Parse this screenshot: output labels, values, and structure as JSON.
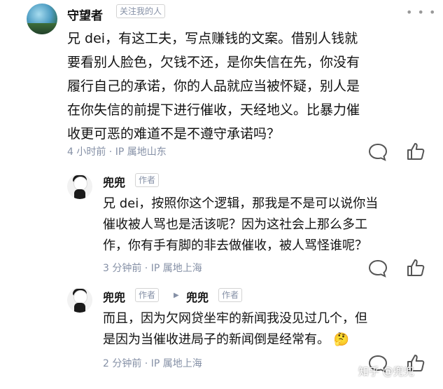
{
  "main_comment": {
    "username": "守望者",
    "follow_tag": "关注我的人",
    "text_lines": [
      "兄 dei，有这工夫，写点赚钱的文案。借别人钱就",
      "要看别人脸色，欠钱不还，是你失信在先，你没有",
      "履行自己的承诺，你的人品就应当被怀疑，别人是",
      "在你失信的前提下进行催收，天经地义。比暴力催",
      "收更可恶的难道不是不遵守承诺吗？"
    ],
    "meta": "4 小时前 · IP 属地山东"
  },
  "reply1": {
    "username": "兜兜",
    "author_tag": "作者",
    "text_lines": [
      "兄 dei，按照你这个逻辑，那我是不是可以说你当",
      "催收被人骂也是活该呢？因为这社会上那么多工",
      "作，你有手有脚的非去做催收，被人骂怪谁呢？"
    ],
    "meta": "3 分钟前 · IP 属地上海"
  },
  "reply2": {
    "username": "兜兜",
    "author_tag": "作者",
    "reply_to_name": "兜兜",
    "reply_to_tag": "作者",
    "text_lines": [
      "而且，因为欠网贷坐牢的新闻我没见过几个，但",
      "是因为当催收进局子的新闻倒是经常有。"
    ],
    "emoji": "🤔",
    "meta": "2 分钟前 · IP 属地上海"
  },
  "watermark": "知乎 @兜兜",
  "icons": {
    "comment": "comment-icon",
    "like": "thumbs-up-icon",
    "menu": "more-dots-icon"
  },
  "colors": {
    "text": "#121212",
    "meta": "#8590a6",
    "tag_border": "#d3d3d3"
  }
}
